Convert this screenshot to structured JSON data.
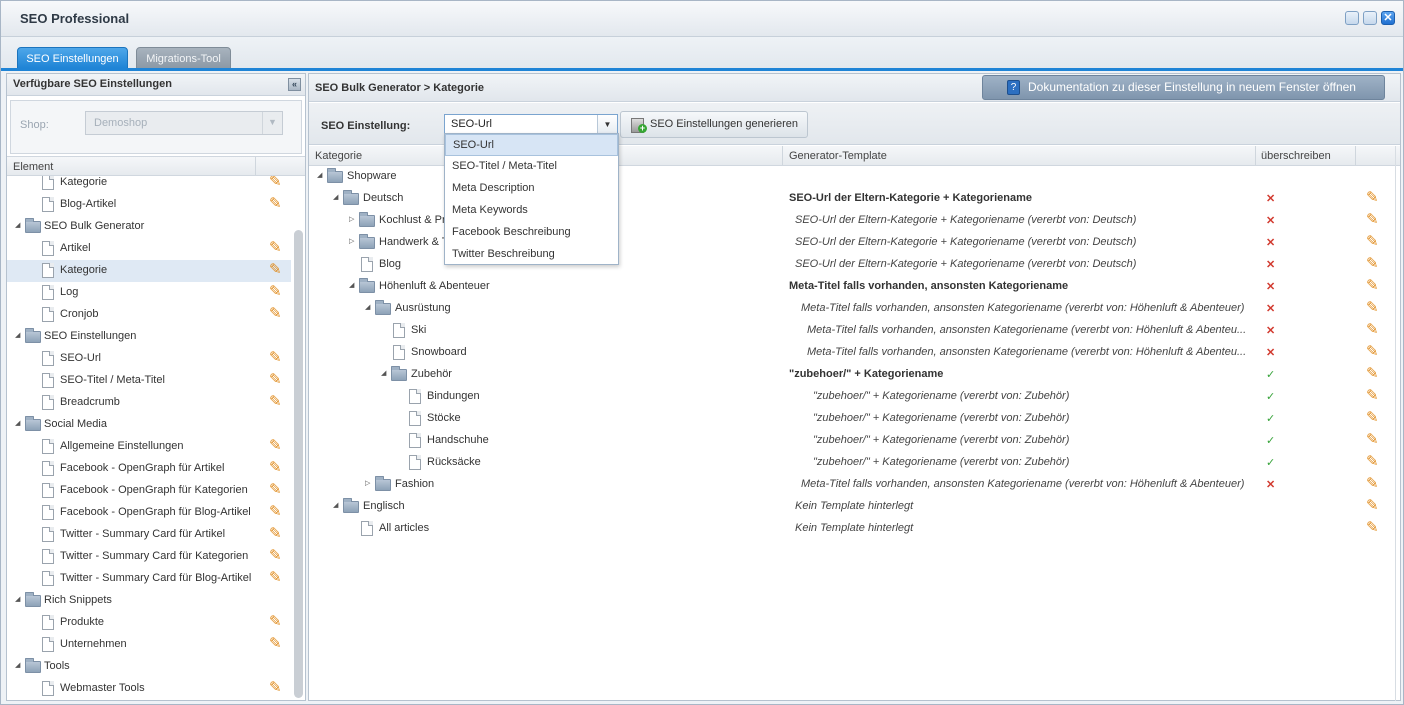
{
  "window": {
    "title": "SEO Professional"
  },
  "tabs": [
    {
      "label": "SEO Einstellungen"
    },
    {
      "label": "Migrations-Tool"
    }
  ],
  "left_panel": {
    "title": "Verfügbare SEO Einstellungen",
    "shop_label": "Shop:",
    "shop_value": "Demoshop",
    "column": "Element",
    "items": [
      {
        "label": "Kategorie",
        "type": "leaf",
        "edit": true
      },
      {
        "label": "Blog-Artikel",
        "type": "leaf",
        "edit": true
      },
      {
        "label": "SEO Bulk Generator",
        "type": "folder",
        "edit": false
      },
      {
        "label": "Artikel",
        "type": "leaf",
        "edit": true
      },
      {
        "label": "Kategorie",
        "type": "leaf",
        "edit": true,
        "selected": true
      },
      {
        "label": "Log",
        "type": "leaf",
        "edit": true
      },
      {
        "label": "Cronjob",
        "type": "leaf",
        "edit": true
      },
      {
        "label": "SEO Einstellungen",
        "type": "folder",
        "edit": false
      },
      {
        "label": "SEO-Url",
        "type": "leaf",
        "edit": true
      },
      {
        "label": "SEO-Titel / Meta-Titel",
        "type": "leaf",
        "edit": true
      },
      {
        "label": "Breadcrumb",
        "type": "leaf",
        "edit": true
      },
      {
        "label": "Social Media",
        "type": "folder",
        "edit": false
      },
      {
        "label": "Allgemeine Einstellungen",
        "type": "leaf",
        "edit": true
      },
      {
        "label": "Facebook - OpenGraph für Artikel",
        "type": "leaf",
        "edit": true
      },
      {
        "label": "Facebook - OpenGraph für Kategorien",
        "type": "leaf",
        "edit": true
      },
      {
        "label": "Facebook - OpenGraph für Blog-Artikel",
        "type": "leaf",
        "edit": true
      },
      {
        "label": "Twitter - Summary Card für Artikel",
        "type": "leaf",
        "edit": true
      },
      {
        "label": "Twitter - Summary Card für Kategorien",
        "type": "leaf",
        "edit": true
      },
      {
        "label": "Twitter - Summary Card für Blog-Artikel",
        "type": "leaf",
        "edit": true
      },
      {
        "label": "Rich Snippets",
        "type": "folder",
        "edit": false
      },
      {
        "label": "Produkte",
        "type": "leaf",
        "edit": true
      },
      {
        "label": "Unternehmen",
        "type": "leaf",
        "edit": true
      },
      {
        "label": "Tools",
        "type": "folder",
        "edit": false
      },
      {
        "label": "Webmaster Tools",
        "type": "leaf",
        "edit": true
      }
    ]
  },
  "right_panel": {
    "breadcrumb": "SEO Bulk Generator > Kategorie",
    "doc_button": "Dokumentation zu dieser Einstellung in neuem Fenster öffnen",
    "setting_label": "SEO Einstellung:",
    "setting_value": "SEO-Url",
    "generate_button": "SEO Einstellungen generieren",
    "columns": {
      "category": "Kategorie",
      "template": "Generator-Template",
      "override": "überschreiben"
    },
    "dropdown_options": [
      "SEO-Url",
      "SEO-Titel / Meta-Titel",
      "Meta Description",
      "Meta Keywords",
      "Facebook Beschreibung",
      "Twitter Beschreibung"
    ],
    "rows": [
      {
        "name": "Shopware",
        "template": "",
        "status": ""
      },
      {
        "name": "Deutsch",
        "template": "SEO-Url der Eltern-Kategorie + Kategoriename",
        "status": "x"
      },
      {
        "name": "Kochlust & Pr",
        "template": "SEO-Url der Eltern-Kategorie + Kategoriename (vererbt von: Deutsch)",
        "status": "x"
      },
      {
        "name": "Handwerk & T",
        "template": "SEO-Url der Eltern-Kategorie + Kategoriename (vererbt von: Deutsch)",
        "status": "x"
      },
      {
        "name": "Blog",
        "template": "SEO-Url der Eltern-Kategorie + Kategoriename (vererbt von: Deutsch)",
        "status": "x"
      },
      {
        "name": "Höhenluft & Abenteuer",
        "template": "Meta-Titel falls vorhanden, ansonsten Kategoriename",
        "status": "x"
      },
      {
        "name": "Ausrüstung",
        "template": "Meta-Titel falls vorhanden, ansonsten Kategoriename (vererbt von: Höhenluft & Abenteuer)",
        "status": "x"
      },
      {
        "name": "Ski",
        "template": "Meta-Titel falls vorhanden, ansonsten Kategoriename (vererbt von: Höhenluft & Abenteu...",
        "status": "x"
      },
      {
        "name": "Snowboard",
        "template": "Meta-Titel falls vorhanden, ansonsten Kategoriename (vererbt von: Höhenluft & Abenteu...",
        "status": "x"
      },
      {
        "name": "Zubehör",
        "template": "\"zubehoer/\" + Kategoriename",
        "status": "check"
      },
      {
        "name": "Bindungen",
        "template": "\"zubehoer/\" + Kategoriename (vererbt von: Zubehör)",
        "status": "check"
      },
      {
        "name": "Stöcke",
        "template": "\"zubehoer/\" + Kategoriename (vererbt von: Zubehör)",
        "status": "check"
      },
      {
        "name": "Handschuhe",
        "template": "\"zubehoer/\" + Kategoriename (vererbt von: Zubehör)",
        "status": "check"
      },
      {
        "name": "Rücksäcke",
        "template": "\"zubehoer/\" + Kategoriename (vererbt von: Zubehör)",
        "status": "check"
      },
      {
        "name": "Fashion",
        "template": "Meta-Titel falls vorhanden, ansonsten Kategoriename (vererbt von: Höhenluft & Abenteuer)",
        "status": "x"
      },
      {
        "name": "Englisch",
        "template": "Kein Template hinterlegt",
        "status": ""
      },
      {
        "name": "All articles",
        "template": "Kein Template hinterlegt",
        "status": ""
      }
    ]
  },
  "colors": {
    "accent": "#1f84d6",
    "error": "#d23a2f",
    "ok": "#37a33a",
    "edit": "#e08a1a"
  }
}
